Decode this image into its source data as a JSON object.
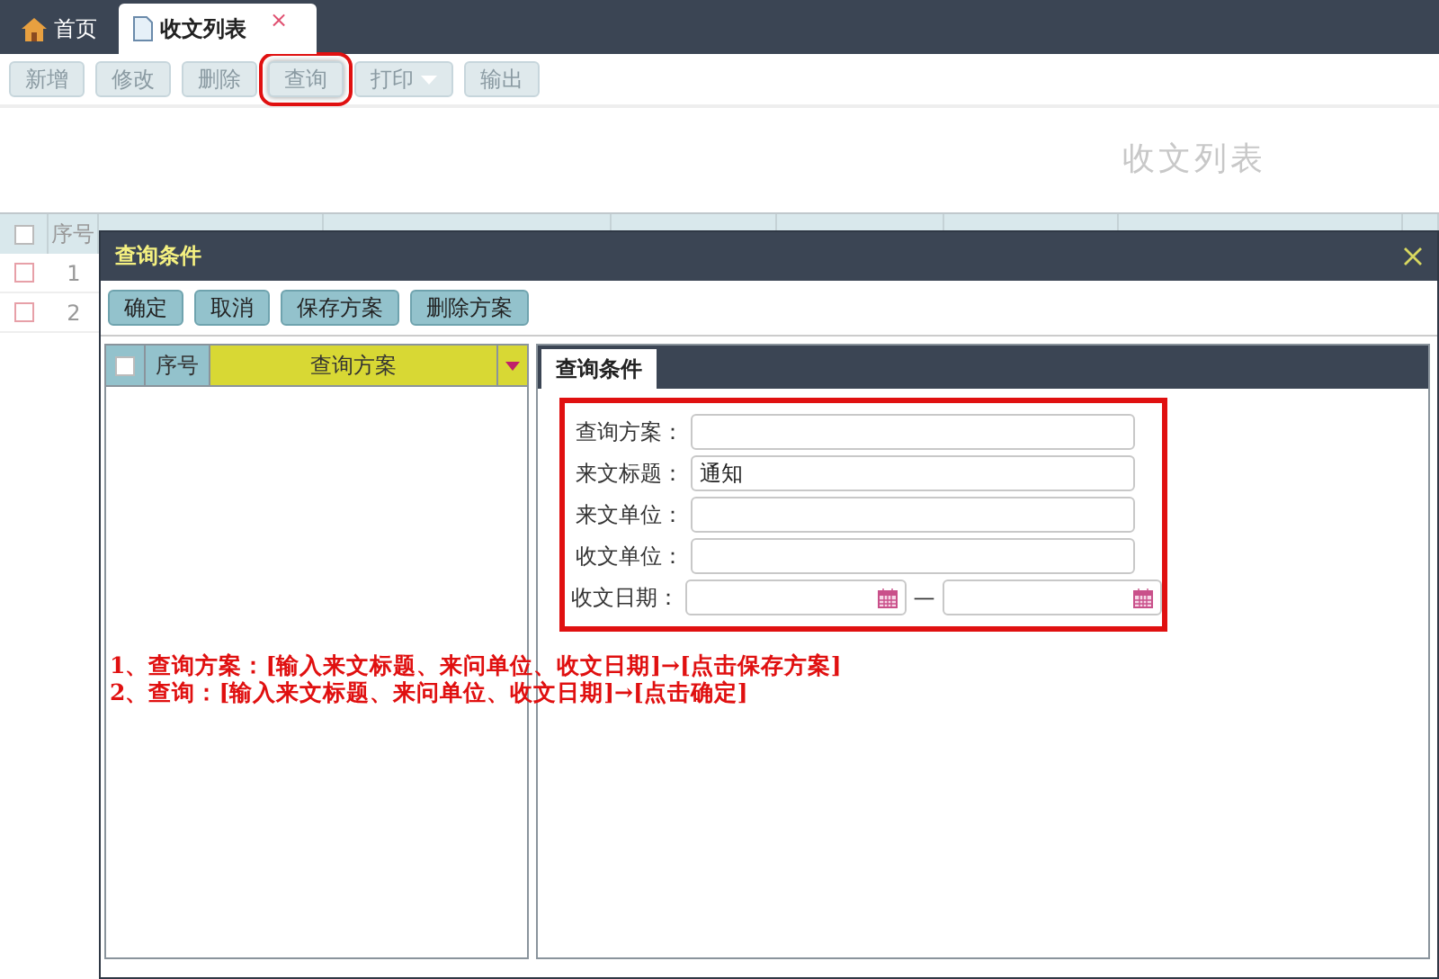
{
  "tabs": [
    {
      "label": "首页",
      "kind": "home",
      "selected": false
    },
    {
      "label": "收文列表",
      "kind": "document",
      "selected": true,
      "close": "×"
    }
  ],
  "toolbar": [
    {
      "label": "新增",
      "highlighted": false
    },
    {
      "label": "修改",
      "highlighted": false
    },
    {
      "label": "删除",
      "highlighted": false
    },
    {
      "label": "查询",
      "highlighted": true
    },
    {
      "label": "打印",
      "highlighted": false,
      "dropdown": true
    },
    {
      "label": "输出",
      "highlighted": false
    }
  ],
  "page_title": "收文列表",
  "table": {
    "all_checked": false,
    "columns": [
      "序号"
    ],
    "rows": [
      {
        "number": "1",
        "checked": false
      },
      {
        "number": "2",
        "checked": false
      }
    ]
  },
  "dialog": {
    "title": "查询条件",
    "buttons": [
      "确定",
      "取消",
      "保存方案",
      "删除方案"
    ],
    "scheme_list": {
      "checked": false,
      "columns": [
        "序号",
        "查询方案"
      ]
    },
    "tabs": [
      {
        "label": "查询条件",
        "selected": true
      }
    ],
    "form": {
      "highlighted": true,
      "fields": [
        {
          "kind": "text",
          "label": "查询方案："
        },
        {
          "kind": "text",
          "label": "来文标题：",
          "value": "通知"
        },
        {
          "kind": "text",
          "label": "来文单位："
        },
        {
          "kind": "text",
          "label": "收文单位："
        },
        {
          "kind": "date_range",
          "label": "收文日期：",
          "separator": "—"
        }
      ]
    },
    "notes": [
      "1、查询方案：[输入来文标题、来问单位、收文日期]→[点击保存方案]",
      "2、查询：[输入来文标题、来问单位、收文日期]→[点击确定]"
    ]
  }
}
